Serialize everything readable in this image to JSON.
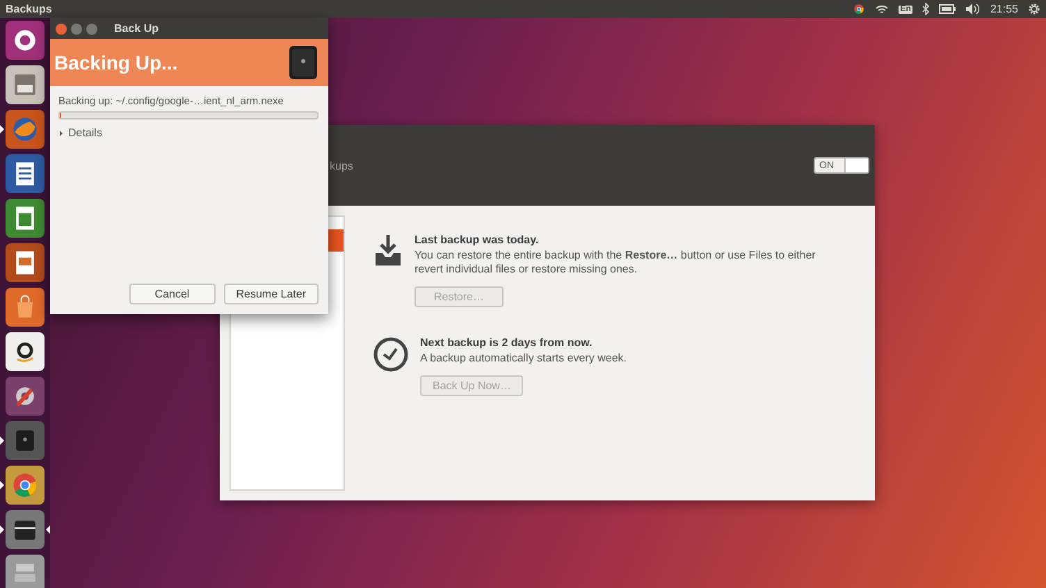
{
  "top_bar": {
    "app_title": "Backups",
    "keyboard_layout": "En",
    "clock": "21:55"
  },
  "launcher": [
    {
      "kind": "ubuntu",
      "running": false,
      "focused": false
    },
    {
      "kind": "files",
      "running": false,
      "focused": false
    },
    {
      "kind": "firefox",
      "running": true,
      "focused": false
    },
    {
      "kind": "writer",
      "running": false,
      "focused": false
    },
    {
      "kind": "calc",
      "running": false,
      "focused": false
    },
    {
      "kind": "impress",
      "running": false,
      "focused": false
    },
    {
      "kind": "software",
      "running": false,
      "focused": false
    },
    {
      "kind": "amazon",
      "running": false,
      "focused": false
    },
    {
      "kind": "settings",
      "running": false,
      "focused": false
    },
    {
      "kind": "backup",
      "running": true,
      "focused": false
    },
    {
      "kind": "chrome",
      "running": true,
      "focused": false
    },
    {
      "kind": "drawer",
      "running": true,
      "focused": true
    },
    {
      "kind": "stack",
      "running": false,
      "focused": false
    }
  ],
  "backups_window": {
    "title": "kups",
    "toggle": {
      "label": "ON",
      "on": true
    },
    "sections": [
      {
        "kind": "download",
        "title": "Last backup was today.",
        "description": "You can restore the entire backup with the **Restore…** button or use Files to either revert individual files or restore missing ones.",
        "button": "Restore…",
        "disabled": true
      },
      {
        "kind": "clock",
        "title": "Next backup is 2 days from now.",
        "description": "A backup automatically starts every week.",
        "button": "Back Up Now…",
        "disabled": true
      }
    ]
  },
  "dialog": {
    "title": "Back Up",
    "heading": "Backing Up...",
    "status": "Backing up: ~/.config/google-…ient_nl_arm.nexe",
    "progress": {
      "level": 0
    },
    "details": {
      "label": "Details",
      "expanded": false
    },
    "buttons": [
      "Cancel",
      "Resume Later"
    ]
  }
}
